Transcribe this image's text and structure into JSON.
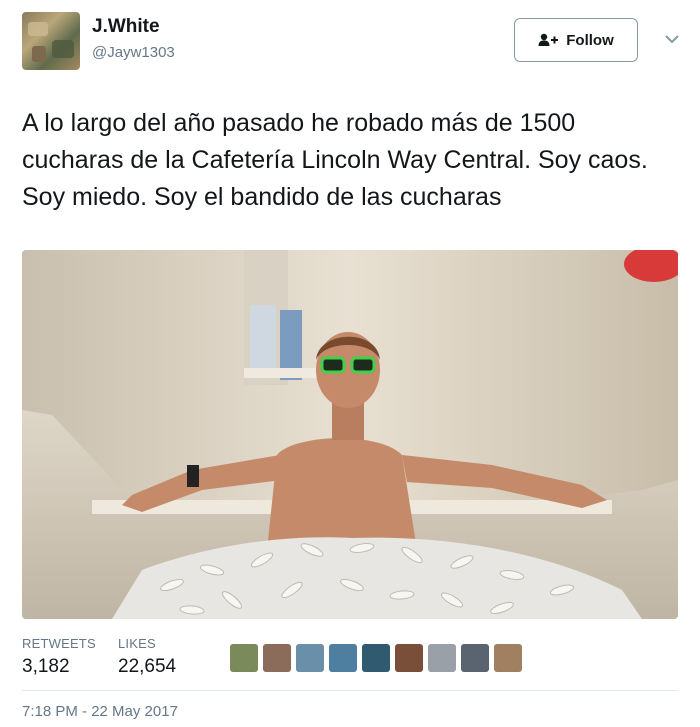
{
  "user": {
    "name": "J.White",
    "handle": "@Jayw1303"
  },
  "follow_button": {
    "label": "Follow",
    "icon": "follow-user-icon"
  },
  "menu": {
    "icon": "chevron-down-icon"
  },
  "tweet": {
    "text": "A lo largo del año pasado he robado más de 1500 cucharas de la Cafetería Lincoln Way Central. Soy caos. Soy miedo. Soy el bandido de las cucharas"
  },
  "stats": {
    "retweets_label": "RETWEETS",
    "retweets_count": "3,182",
    "likes_label": "LIKES",
    "likes_count": "22,654"
  },
  "liker_avatars": [
    {
      "color": "#7a8a5a"
    },
    {
      "color": "#8b6b5a"
    },
    {
      "color": "#6a8fa8"
    },
    {
      "color": "#4f7fa0"
    },
    {
      "color": "#2f5a6f"
    },
    {
      "color": "#7a4f3a"
    },
    {
      "color": "#9aa0a8"
    },
    {
      "color": "#5a6470"
    },
    {
      "color": "#a08060"
    }
  ],
  "timestamp": "7:18 PM - 22 May 2017",
  "colors": {
    "text": "#14171a",
    "secondary": "#657786",
    "border": "#e1e8ed"
  }
}
